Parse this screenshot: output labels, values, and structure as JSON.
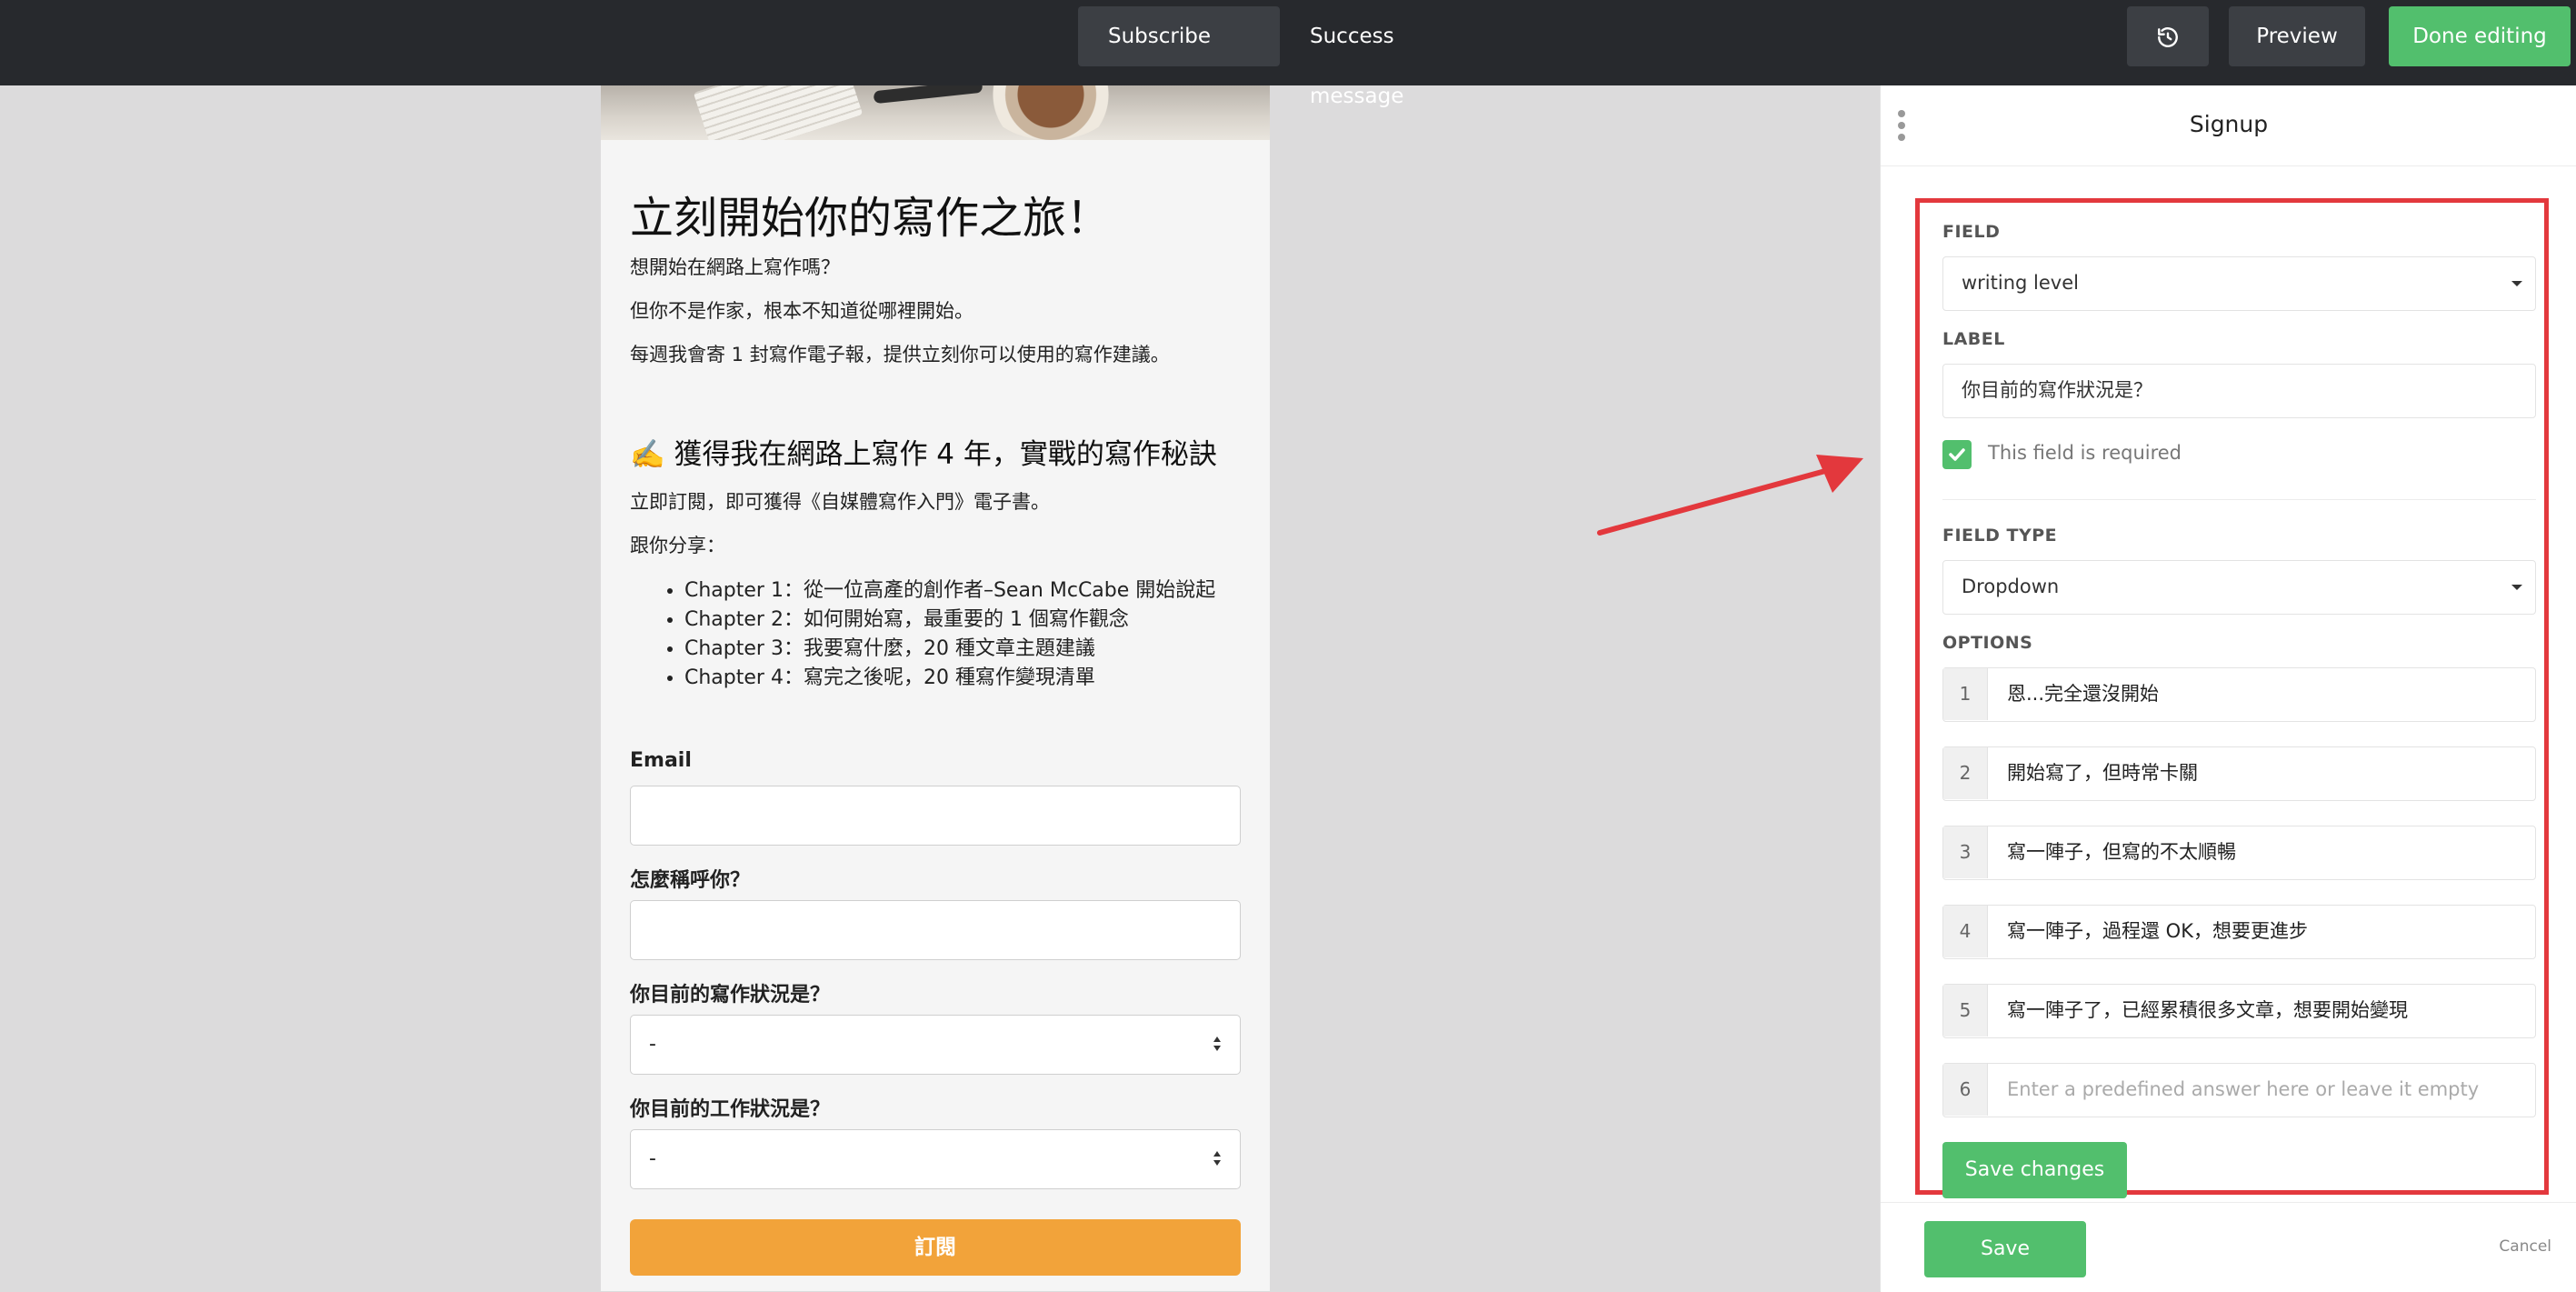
{
  "topbar": {
    "tabs": [
      "Subscribe form",
      "Success message"
    ],
    "active_tab": "Subscribe form",
    "history_icon": "history-icon",
    "preview_label": "Preview",
    "done_label": "Done editing",
    "done_color": "#52bf6d"
  },
  "form": {
    "title": "立刻開始你的寫作之旅！",
    "intro": [
      "想開始在網路上寫作嗎？",
      "但你不是作家，根本不知道從哪裡開始。",
      "每週我會寄 1 封寫作電子報，提供立刻你可以使用的寫作建議。"
    ],
    "subtitle": "✍️ 獲得我在網路上寫作 4 年，實戰的寫作秘訣",
    "offer": "立即訂閱，即可獲得《自媒體寫作入門》電子書。",
    "share": "跟你分享：",
    "chapters": [
      "Chapter 1：從一位高產的創作者–Sean McCabe 開始說起",
      "Chapter 2：如何開始寫，最重要的 1 個寫作觀念",
      "Chapter 3：我要寫什麼，20 種文章主題建議",
      "Chapter 4：寫完之後呢，20 種寫作變現清單"
    ],
    "email_label": "Email",
    "name_label": "怎麼稱呼你？",
    "writing_label": "你目前的寫作狀況是？",
    "writing_value": "-",
    "work_label": "你目前的工作狀況是？",
    "work_value": "-",
    "submit_label": "訂閱",
    "submit_color": "#f2a33a"
  },
  "panel": {
    "title": "Signup",
    "field_label": "FIELD",
    "field_value": "writing level",
    "label_label": "LABEL",
    "label_value": "你目前的寫作狀況是？",
    "required_label": "This field is required",
    "required_checked": true,
    "field_type_label": "FIELD TYPE",
    "field_type_value": "Dropdown",
    "options_label": "OPTIONS",
    "options": [
      {
        "num": "1",
        "text": "恩...完全還沒開始"
      },
      {
        "num": "2",
        "text": "開始寫了，但時常卡關"
      },
      {
        "num": "3",
        "text": "寫一陣子，但寫的不太順暢"
      },
      {
        "num": "4",
        "text": "寫一陣子，過程還 OK，想要更進步"
      },
      {
        "num": "5",
        "text": "寫一陣子了，已經累積很多文章，想要開始變現"
      },
      {
        "num": "6",
        "placeholder": "Enter a predefined answer here or leave it empty"
      }
    ],
    "save_changes_label": "Save changes",
    "save_label": "Save",
    "cancel_label": "Cancel",
    "highlight_color": "#e3383d"
  }
}
